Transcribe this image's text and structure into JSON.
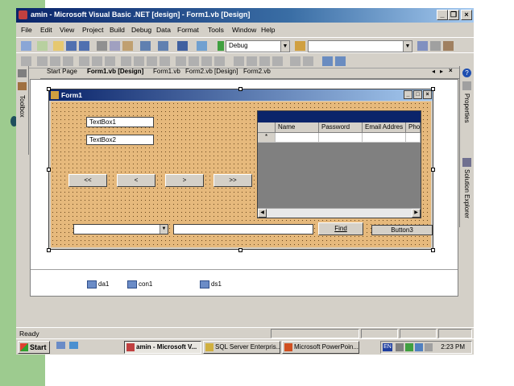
{
  "window": {
    "title": "amin - Microsoft Visual Basic .NET [design] - Form1.vb [Design]",
    "minimize": "_",
    "restore": "❐",
    "close": "×"
  },
  "menu": [
    "File",
    "Edit",
    "View",
    "Project",
    "Build",
    "Debug",
    "Data",
    "Format",
    "Tools",
    "Window",
    "Help"
  ],
  "toolbar": {
    "config_combo": "Debug",
    "search_combo": ""
  },
  "tabs": [
    "Start Page",
    "Form1.vb [Design]",
    "Form1.vb",
    "Form2.vb [Design]",
    "Form2.vb"
  ],
  "docks": {
    "left": "Toolbox",
    "right_top": "Properties",
    "right_bottom": "Solution Explorer"
  },
  "form": {
    "title": "Form1",
    "textbox1": "TextBox1",
    "textbox2": "TextBox2",
    "nav_buttons": [
      "<<",
      "<",
      ">",
      ">>"
    ],
    "grid_columns": [
      "Name",
      "Password",
      "Email Addres",
      "Pho"
    ],
    "grid_new_row_marker": "*",
    "find_button": "Find",
    "button3": "Button3"
  },
  "component_tray": [
    "da1",
    "con1",
    "ds1"
  ],
  "status": "Ready",
  "taskbar": {
    "start": "Start",
    "tasks": [
      "amin - Microsoft V...",
      "SQL Server Enterpris...",
      "Microsoft PowerPoin..."
    ],
    "lang": "EN",
    "clock": "2:23 PM"
  },
  "colors": {
    "form_bg": "#e6b97c",
    "titlebar": "#0a246a",
    "slide_green": "#9dcb8f"
  }
}
